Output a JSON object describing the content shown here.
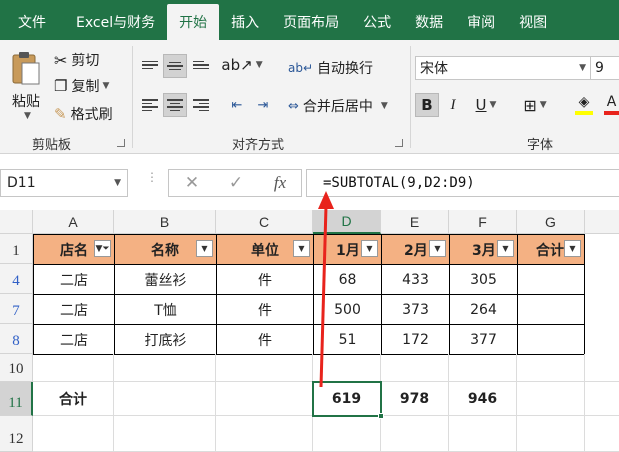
{
  "tabs": [
    "文件",
    "Excel与财务",
    "开始",
    "插入",
    "页面布局",
    "公式",
    "数据",
    "审阅",
    "视图"
  ],
  "active_tab": "开始",
  "clipboard": {
    "paste_label": "粘贴",
    "cut_label": "剪切",
    "copy_label": "复制",
    "format_painter_label": "格式刷",
    "group_label": "剪贴板"
  },
  "alignment": {
    "wrap_label": "自动换行",
    "merge_label": "合并后居中",
    "group_label": "对齐方式"
  },
  "font": {
    "name": "宋体",
    "size": "9",
    "bold": "B",
    "italic": "I",
    "underline": "U",
    "group_label": "字体"
  },
  "formula_bar": {
    "name_box": "D11",
    "formula": "=SUBTOTAL(9,D2:D9)",
    "fx": "fx"
  },
  "sheet": {
    "columns": [
      "A",
      "B",
      "C",
      "D",
      "E",
      "F",
      "G"
    ],
    "selected_column": "D",
    "rows": [
      {
        "num": "1",
        "cells": [
          "店名",
          "名称",
          "单位",
          "1月",
          "2月",
          "3月",
          "合计"
        ]
      },
      {
        "num": "4",
        "cells": [
          "二店",
          "蕾丝衫",
          "件",
          "68",
          "433",
          "305",
          ""
        ]
      },
      {
        "num": "7",
        "cells": [
          "二店",
          "T恤",
          "件",
          "500",
          "373",
          "264",
          ""
        ]
      },
      {
        "num": "8",
        "cells": [
          "二店",
          "打底衫",
          "件",
          "51",
          "172",
          "377",
          ""
        ]
      },
      {
        "num": "10",
        "cells": [
          "",
          "",
          "",
          "",
          "",
          "",
          ""
        ]
      },
      {
        "num": "11",
        "cells": [
          "合计",
          "",
          "",
          "619",
          "978",
          "946",
          ""
        ]
      },
      {
        "num": "12",
        "cells": [
          "",
          "",
          "",
          "",
          "",
          "",
          ""
        ]
      }
    ],
    "selected_row": "11",
    "active_cell": "D11",
    "header_fill": "#f4b183",
    "accent": "#217346",
    "annotation_color": "#e8231c"
  }
}
